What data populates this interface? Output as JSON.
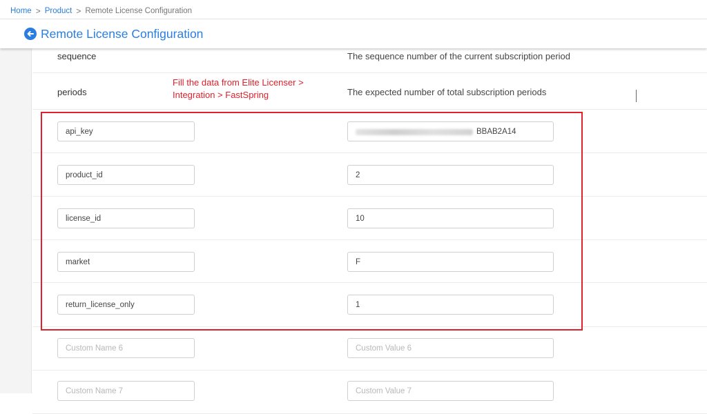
{
  "breadcrumb": {
    "home": "Home",
    "product": "Product",
    "current": "Remote License Configuration",
    "sep": ">"
  },
  "header": {
    "title": "Remote License Configuration",
    "back_icon": "arrow-left-circle-icon"
  },
  "rows_static": [
    {
      "param": "sequence",
      "description": "The sequence number of the current subscription period"
    },
    {
      "param": "periods",
      "description": "The expected number of total subscription periods"
    }
  ],
  "note": "Fill the data from Elite Licenser > Integration > FastSpring",
  "fields": [
    {
      "name": "api_key",
      "value": "BBAB2A14",
      "name_placeholder": "",
      "value_placeholder": ""
    },
    {
      "name": "product_id",
      "value": "2",
      "name_placeholder": "",
      "value_placeholder": ""
    },
    {
      "name": "license_id",
      "value": "10",
      "name_placeholder": "",
      "value_placeholder": ""
    },
    {
      "name": "market",
      "value": "F",
      "name_placeholder": "",
      "value_placeholder": ""
    },
    {
      "name": "return_license_only",
      "value": "1",
      "name_placeholder": "",
      "value_placeholder": ""
    },
    {
      "name": "",
      "value": "",
      "name_placeholder": "Custom Name 6",
      "value_placeholder": "Custom Value 6"
    },
    {
      "name": "",
      "value": "",
      "name_placeholder": "Custom Name 7",
      "value_placeholder": "Custom Value 7"
    }
  ],
  "colors": {
    "accent": "#2a7ee0",
    "highlight": "#e0202a"
  }
}
